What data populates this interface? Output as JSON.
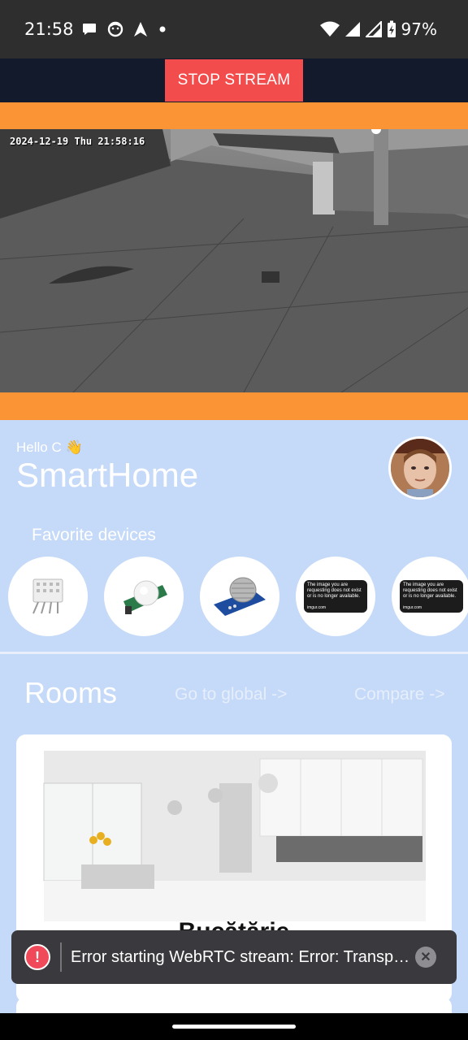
{
  "status_bar": {
    "time": "21:58",
    "battery": "97%",
    "left_icons": [
      "chat-bubble-icon",
      "face-icon",
      "navigation-arrow-icon",
      "dot-icon"
    ],
    "right_icons": [
      "wifi-icon",
      "signal-icon",
      "signal-icon",
      "battery-charging-icon"
    ]
  },
  "stream": {
    "stop_label": "STOP STREAM",
    "timestamp": "2024-12-19 Thu 21:58:16",
    "accent_color": "#fa9435",
    "button_color": "#f34c4c"
  },
  "header": {
    "greeting": "Hello C 👋",
    "title": "SmartHome"
  },
  "favorites": {
    "label": "Favorite devices",
    "items": [
      {
        "name": "humidity-sensor"
      },
      {
        "name": "pir-motion-sensor"
      },
      {
        "name": "gas-sensor"
      },
      {
        "name": "image-unavailable",
        "text": "The image you are requesting does not exist or is no longer available.",
        "footer": "imgur.com"
      },
      {
        "name": "image-unavailable",
        "text": "The image you are requesting does not exist or is no longer available.",
        "footer": "imgur.com"
      }
    ]
  },
  "rooms": {
    "title": "Rooms",
    "global_link": "Go to global ->",
    "compare_link": "Compare ->",
    "cards": [
      {
        "name": "Bucătărie"
      }
    ]
  },
  "snackbar": {
    "message": "Error starting WebRTC stream: Error: Transport failed"
  }
}
